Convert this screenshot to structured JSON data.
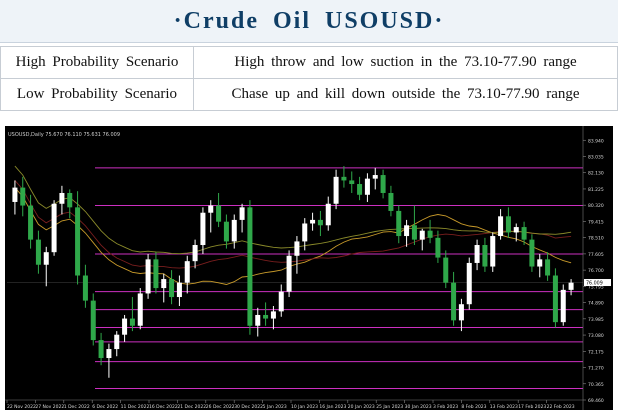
{
  "header": {
    "title": "·Crude Oil USOUSD·"
  },
  "scenarios": [
    {
      "label": "High Probability Scenario",
      "text": "High throw and low suction in the 73.10-77.90 range"
    },
    {
      "label": "Low Probability Scenario",
      "text": "Chase up and kill down outside the 73.10-77.90 range"
    }
  ],
  "colors": {
    "background": "#000000",
    "bull": "#ffffff",
    "bear": "#2fa84a",
    "levels": "#cc2fc0",
    "ma_fast": "#c89a2a",
    "ma_slow": "#7a1e1e",
    "ma_long": "#8a8a2a"
  },
  "chart_data": {
    "type": "candlestick",
    "symbol_info": "USOUSD,Daily 75.670 76.110 75.631 76.009",
    "x_tick_labels": [
      "22 Nov 2022",
      "27 Nov 2022",
      "1 Dec 2022",
      "6 Dec 2022",
      "11 Dec 2022",
      "16 Dec 2022",
      "21 Dec 2022",
      "26 Dec 2022",
      "30 Dec 2022",
      "5 Jan 2023",
      "10 Jan 2023",
      "16 Jan 2023",
      "20 Jan 2023",
      "25 Jan 2023",
      "30 Jan 2023",
      "3 Feb 2023",
      "8 Feb 2023",
      "13 Feb 2023",
      "17 Feb 2023",
      "22 Feb 2023"
    ],
    "y_tick_labels": [
      "83.940",
      "83.035",
      "82.130",
      "81.225",
      "80.320",
      "79.415",
      "78.510",
      "77.605",
      "76.700",
      "75.795",
      "74.890",
      "73.985",
      "73.080",
      "72.175",
      "71.270",
      "70.365",
      "69.460"
    ],
    "current_price": "76.009",
    "ylim": [
      69.46,
      84.4
    ],
    "horizontal_levels": [
      82.4,
      80.3,
      77.6,
      75.5,
      74.5,
      73.5,
      72.7,
      71.6,
      70.1
    ],
    "candles": [
      {
        "o": 80.5,
        "h": 81.7,
        "l": 79.8,
        "c": 81.3
      },
      {
        "o": 81.3,
        "h": 81.9,
        "l": 79.7,
        "c": 80.3
      },
      {
        "o": 80.3,
        "h": 80.9,
        "l": 77.9,
        "c": 78.4
      },
      {
        "o": 78.4,
        "h": 78.9,
        "l": 76.5,
        "c": 77.0
      },
      {
        "o": 77.0,
        "h": 78.0,
        "l": 75.8,
        "c": 77.7
      },
      {
        "o": 77.7,
        "h": 80.6,
        "l": 77.5,
        "c": 80.4
      },
      {
        "o": 80.4,
        "h": 81.4,
        "l": 79.8,
        "c": 81.0
      },
      {
        "o": 81.0,
        "h": 81.2,
        "l": 79.6,
        "c": 80.2
      },
      {
        "o": 80.2,
        "h": 81.1,
        "l": 75.9,
        "c": 76.4
      },
      {
        "o": 76.4,
        "h": 77.0,
        "l": 74.6,
        "c": 75.0
      },
      {
        "o": 75.0,
        "h": 75.4,
        "l": 72.5,
        "c": 72.8
      },
      {
        "o": 72.8,
        "h": 73.2,
        "l": 71.4,
        "c": 71.8
      },
      {
        "o": 71.8,
        "h": 72.6,
        "l": 70.7,
        "c": 72.3
      },
      {
        "o": 72.3,
        "h": 73.3,
        "l": 71.9,
        "c": 73.1
      },
      {
        "o": 73.1,
        "h": 74.2,
        "l": 72.7,
        "c": 74.0
      },
      {
        "o": 74.0,
        "h": 75.2,
        "l": 73.3,
        "c": 73.6
      },
      {
        "o": 73.6,
        "h": 75.7,
        "l": 73.4,
        "c": 75.4
      },
      {
        "o": 75.4,
        "h": 77.6,
        "l": 75.1,
        "c": 77.3
      },
      {
        "o": 77.3,
        "h": 77.7,
        "l": 75.4,
        "c": 75.7
      },
      {
        "o": 75.7,
        "h": 76.5,
        "l": 74.9,
        "c": 76.2
      },
      {
        "o": 76.2,
        "h": 76.7,
        "l": 74.8,
        "c": 75.2
      },
      {
        "o": 75.2,
        "h": 76.4,
        "l": 74.7,
        "c": 76.0
      },
      {
        "o": 76.0,
        "h": 77.5,
        "l": 75.4,
        "c": 77.2
      },
      {
        "o": 77.2,
        "h": 78.4,
        "l": 76.8,
        "c": 78.1
      },
      {
        "o": 78.1,
        "h": 80.2,
        "l": 77.6,
        "c": 79.9
      },
      {
        "o": 79.9,
        "h": 80.6,
        "l": 78.8,
        "c": 80.3
      },
      {
        "o": 80.3,
        "h": 81.0,
        "l": 79.1,
        "c": 79.4
      },
      {
        "o": 79.4,
        "h": 79.8,
        "l": 77.9,
        "c": 78.3
      },
      {
        "o": 78.3,
        "h": 79.8,
        "l": 77.9,
        "c": 79.5
      },
      {
        "o": 79.5,
        "h": 80.4,
        "l": 78.8,
        "c": 80.2
      },
      {
        "o": 80.2,
        "h": 80.6,
        "l": 73.1,
        "c": 73.6
      },
      {
        "o": 73.6,
        "h": 74.6,
        "l": 73.0,
        "c": 74.2
      },
      {
        "o": 74.2,
        "h": 74.9,
        "l": 73.6,
        "c": 74.0
      },
      {
        "o": 74.0,
        "h": 74.7,
        "l": 73.4,
        "c": 74.4
      },
      {
        "o": 74.4,
        "h": 75.9,
        "l": 74.1,
        "c": 75.5
      },
      {
        "o": 75.5,
        "h": 77.8,
        "l": 75.2,
        "c": 77.5
      },
      {
        "o": 77.5,
        "h": 78.6,
        "l": 76.5,
        "c": 78.3
      },
      {
        "o": 78.3,
        "h": 79.6,
        "l": 77.8,
        "c": 79.3
      },
      {
        "o": 79.3,
        "h": 79.9,
        "l": 78.9,
        "c": 79.5
      },
      {
        "o": 79.5,
        "h": 80.0,
        "l": 78.6,
        "c": 79.2
      },
      {
        "o": 79.2,
        "h": 80.8,
        "l": 78.9,
        "c": 80.4
      },
      {
        "o": 80.4,
        "h": 82.3,
        "l": 80.1,
        "c": 81.9
      },
      {
        "o": 81.9,
        "h": 82.5,
        "l": 81.3,
        "c": 81.7
      },
      {
        "o": 81.7,
        "h": 82.2,
        "l": 81.0,
        "c": 81.5
      },
      {
        "o": 81.5,
        "h": 81.9,
        "l": 80.6,
        "c": 80.9
      },
      {
        "o": 80.9,
        "h": 82.1,
        "l": 80.5,
        "c": 81.8
      },
      {
        "o": 81.8,
        "h": 82.4,
        "l": 81.2,
        "c": 82.0
      },
      {
        "o": 82.0,
        "h": 82.3,
        "l": 80.7,
        "c": 81.0
      },
      {
        "o": 81.0,
        "h": 81.4,
        "l": 79.7,
        "c": 80.0
      },
      {
        "o": 80.0,
        "h": 80.3,
        "l": 78.2,
        "c": 78.6
      },
      {
        "o": 78.6,
        "h": 79.5,
        "l": 78.0,
        "c": 79.2
      },
      {
        "o": 79.2,
        "h": 80.3,
        "l": 78.1,
        "c": 78.4
      },
      {
        "o": 78.4,
        "h": 79.0,
        "l": 77.8,
        "c": 78.9
      },
      {
        "o": 78.9,
        "h": 79.5,
        "l": 78.2,
        "c": 78.5
      },
      {
        "o": 78.5,
        "h": 78.9,
        "l": 77.1,
        "c": 77.4
      },
      {
        "o": 77.4,
        "h": 77.8,
        "l": 75.7,
        "c": 76.0
      },
      {
        "o": 76.0,
        "h": 76.6,
        "l": 73.6,
        "c": 73.9
      },
      {
        "o": 73.9,
        "h": 75.1,
        "l": 73.3,
        "c": 74.8
      },
      {
        "o": 74.8,
        "h": 77.4,
        "l": 74.5,
        "c": 77.1
      },
      {
        "o": 77.1,
        "h": 78.4,
        "l": 76.7,
        "c": 78.1
      },
      {
        "o": 78.1,
        "h": 78.5,
        "l": 76.6,
        "c": 76.9
      },
      {
        "o": 76.9,
        "h": 78.8,
        "l": 76.6,
        "c": 78.6
      },
      {
        "o": 78.6,
        "h": 80.1,
        "l": 78.4,
        "c": 79.7
      },
      {
        "o": 79.7,
        "h": 80.2,
        "l": 78.5,
        "c": 78.8
      },
      {
        "o": 78.8,
        "h": 79.3,
        "l": 78.3,
        "c": 79.1
      },
      {
        "o": 79.1,
        "h": 79.4,
        "l": 78.1,
        "c": 78.4
      },
      {
        "o": 78.4,
        "h": 78.7,
        "l": 76.6,
        "c": 76.9
      },
      {
        "o": 76.9,
        "h": 77.6,
        "l": 76.3,
        "c": 77.3
      },
      {
        "o": 77.3,
        "h": 77.7,
        "l": 76.1,
        "c": 76.4
      },
      {
        "o": 76.4,
        "h": 76.8,
        "l": 73.5,
        "c": 73.8
      },
      {
        "o": 73.8,
        "h": 75.9,
        "l": 73.6,
        "c": 75.6
      },
      {
        "o": 75.6,
        "h": 76.2,
        "l": 75.3,
        "c": 76.0
      }
    ]
  }
}
